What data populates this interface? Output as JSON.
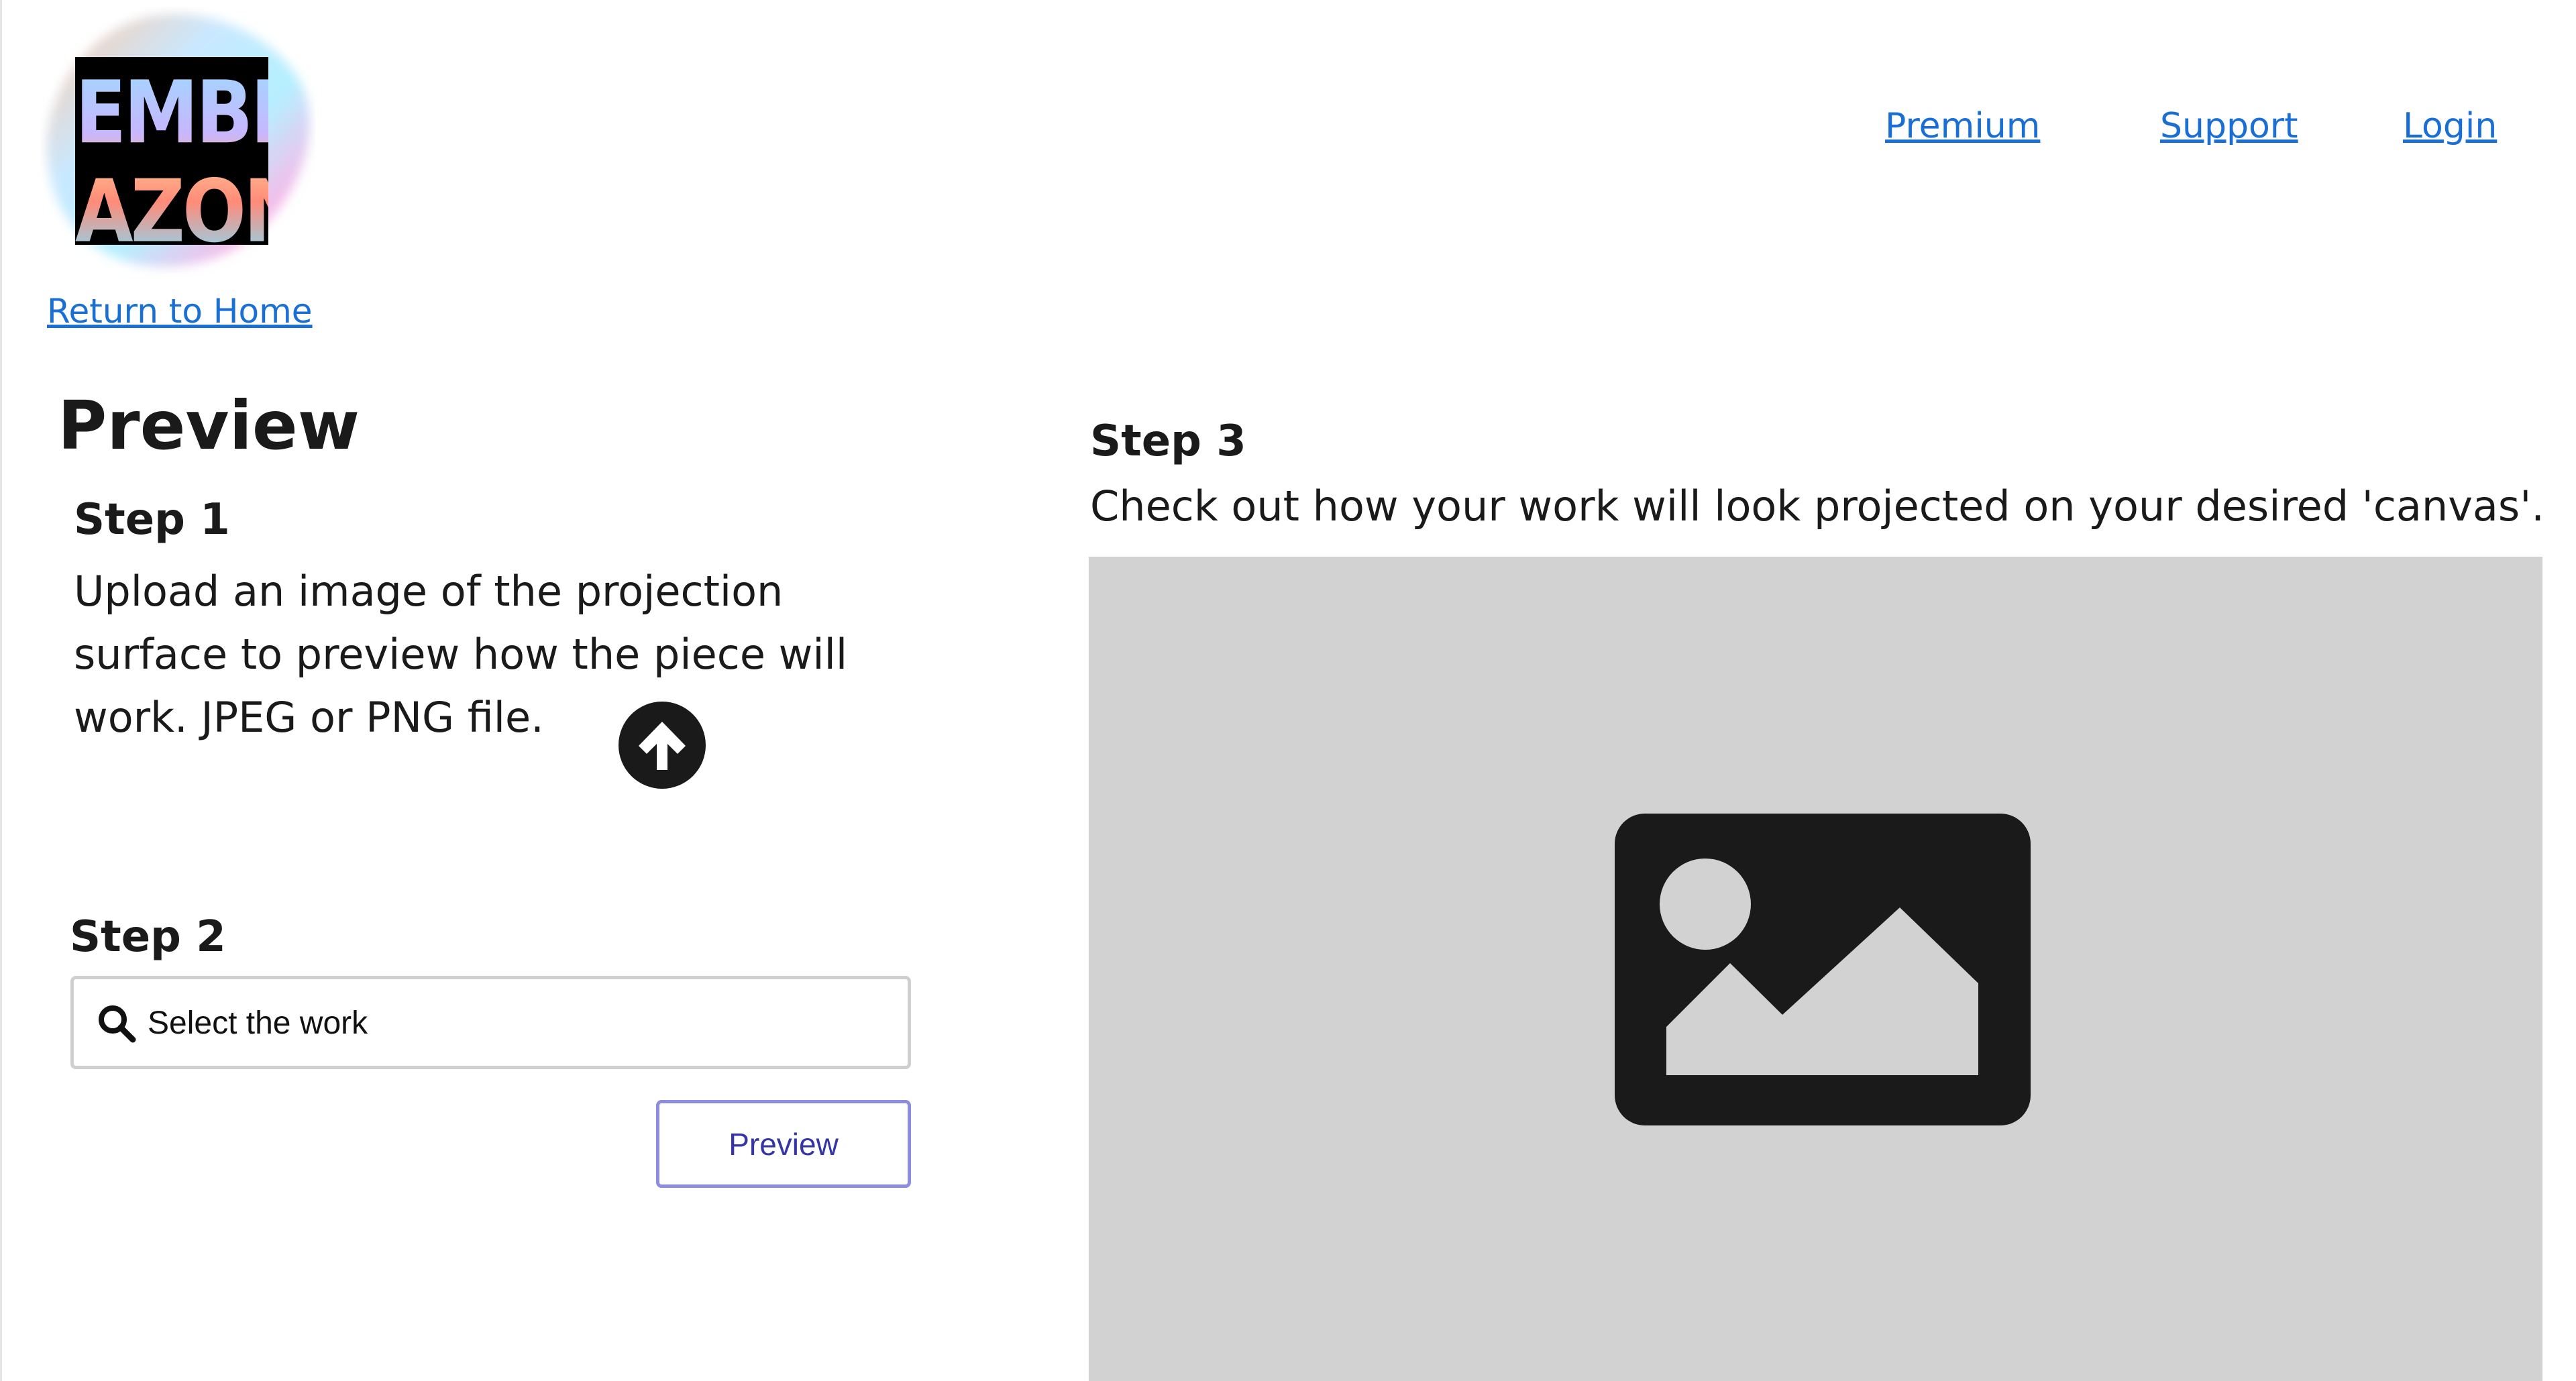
{
  "brand": {
    "logo_text_line1": "EMBL",
    "logo_text_line2": "AZON",
    "return_home": "Return to Home"
  },
  "nav": {
    "items": [
      {
        "label": "Premium"
      },
      {
        "label": "Support"
      },
      {
        "label": "Login"
      }
    ]
  },
  "main": {
    "title": "Preview",
    "step1": {
      "heading": "Step 1",
      "description": "Upload an image of the projection surface to preview how the piece will work. JPEG or PNG file.",
      "upload_icon": "upload-arrow-icon"
    },
    "step2": {
      "heading": "Step 2",
      "search_placeholder": "Select the work",
      "search_value": "",
      "search_icon": "search-icon",
      "preview_button": "Preview"
    },
    "step3": {
      "heading": "Step 3",
      "description": "Check out how your work will look projected on your desired 'canvas'.",
      "placeholder_icon": "image-placeholder-icon"
    }
  },
  "colors": {
    "link": "#1a6fd6",
    "button_border": "#8c8ce0",
    "button_text": "#3535a8",
    "canvas_bg": "#d2d2d2",
    "icon_dark": "#1a1a1a"
  }
}
